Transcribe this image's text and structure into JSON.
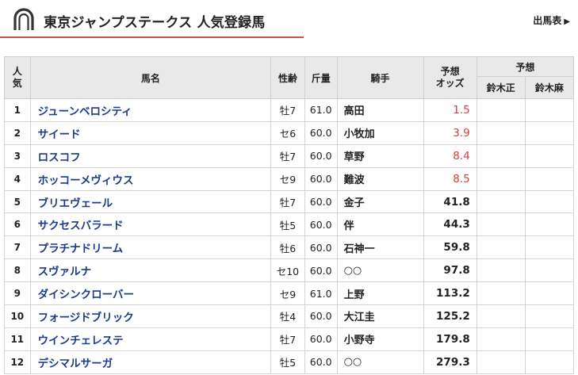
{
  "header": {
    "title": "東京ジャンプステークス 人気登録馬",
    "link_label": "出馬表",
    "link_arrow": "▶"
  },
  "table": {
    "headers": {
      "ninki_1": "人",
      "ninki_2": "気",
      "horse": "馬名",
      "sex_age": "性齢",
      "weight": "斤量",
      "jockey": "騎手",
      "odds_1": "予想",
      "odds_2": "オッズ",
      "yoso": "予想",
      "predictor_1": "鈴木正",
      "predictor_2": "鈴木麻"
    },
    "rows": [
      {
        "rank": "1",
        "horse": "ジューンベロシティ",
        "sex_age": "牡7",
        "weight": "61.0",
        "jockey": "高田",
        "odds": "1.5",
        "hot": true
      },
      {
        "rank": "2",
        "horse": "サイード",
        "sex_age": "セ6",
        "weight": "60.0",
        "jockey": "小牧加",
        "odds": "3.9",
        "hot": true
      },
      {
        "rank": "3",
        "horse": "ロスコフ",
        "sex_age": "牡7",
        "weight": "60.0",
        "jockey": "草野",
        "odds": "8.4",
        "hot": true
      },
      {
        "rank": "4",
        "horse": "ホッコーメヴィウス",
        "sex_age": "セ9",
        "weight": "60.0",
        "jockey": "難波",
        "odds": "8.5",
        "hot": true
      },
      {
        "rank": "5",
        "horse": "ブリエヴェール",
        "sex_age": "牡7",
        "weight": "60.0",
        "jockey": "金子",
        "odds": "41.8",
        "hot": false
      },
      {
        "rank": "6",
        "horse": "サクセスバラード",
        "sex_age": "牡5",
        "weight": "60.0",
        "jockey": "伴",
        "odds": "44.3",
        "hot": false
      },
      {
        "rank": "7",
        "horse": "プラチナドリーム",
        "sex_age": "牡6",
        "weight": "60.0",
        "jockey": "石神一",
        "odds": "59.8",
        "hot": false
      },
      {
        "rank": "8",
        "horse": "スヴァルナ",
        "sex_age": "セ10",
        "weight": "60.0",
        "jockey": "○○",
        "odds": "97.8",
        "hot": false
      },
      {
        "rank": "9",
        "horse": "ダイシンクローバー",
        "sex_age": "セ9",
        "weight": "61.0",
        "jockey": "上野",
        "odds": "113.2",
        "hot": false
      },
      {
        "rank": "10",
        "horse": "フォージドブリック",
        "sex_age": "牡4",
        "weight": "60.0",
        "jockey": "大江圭",
        "odds": "125.2",
        "hot": false
      },
      {
        "rank": "11",
        "horse": "ウインチェレステ",
        "sex_age": "牡7",
        "weight": "60.0",
        "jockey": "小野寺",
        "odds": "179.8",
        "hot": false
      },
      {
        "rank": "12",
        "horse": "デシマルサーガ",
        "sex_age": "牡5",
        "weight": "60.0",
        "jockey": "○○",
        "odds": "279.3",
        "hot": false
      }
    ]
  },
  "colors": {
    "accent_line": "#c8524a",
    "horse_link": "#1a3a8c",
    "hot_odds": "#d0413c",
    "header_bg": "#e9e9e9"
  },
  "icons": {
    "logo": "horseshoe-icon",
    "link": "triangle-right-icon"
  }
}
